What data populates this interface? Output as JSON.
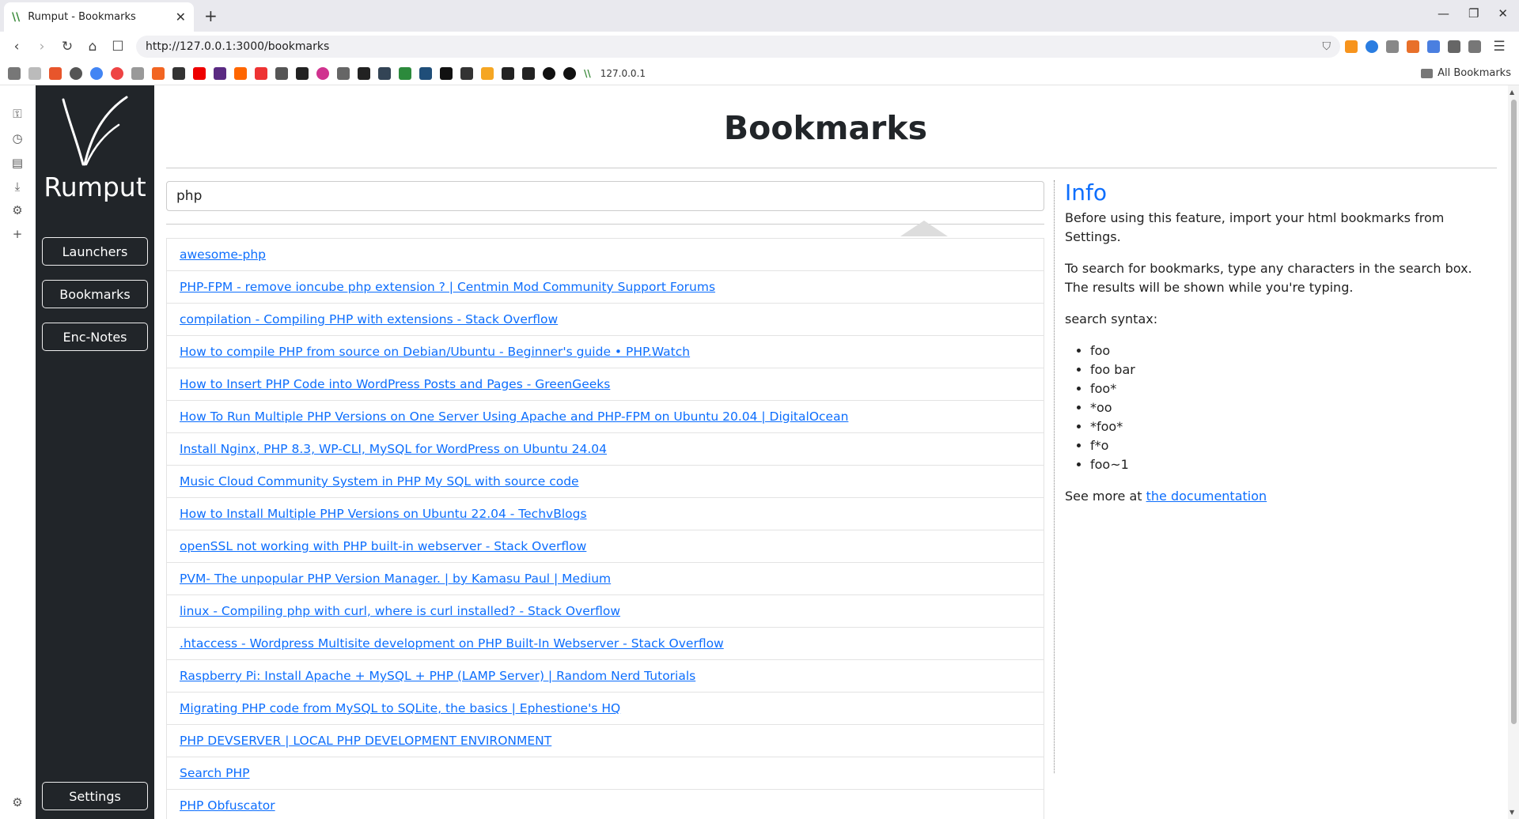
{
  "browser": {
    "tab_title": "Rumput - Bookmarks",
    "url": "http://127.0.0.1:3000/bookmarks",
    "bookmarks_host": "127.0.0.1",
    "all_bookmarks": "All Bookmarks"
  },
  "sidebar": {
    "brand": "Rumput",
    "nav": [
      "Launchers",
      "Bookmarks",
      "Enc-Notes"
    ],
    "settings": "Settings"
  },
  "page": {
    "title": "Bookmarks",
    "search_value": "php"
  },
  "results": [
    "awesome-php",
    "PHP-FPM - remove ioncube php extension ? | Centmin Mod Community Support Forums",
    "compilation - Compiling PHP with extensions - Stack Overflow",
    "How to compile PHP from source on Debian/Ubuntu - Beginner's guide • PHP.Watch",
    "How to Insert PHP Code into WordPress Posts and Pages - GreenGeeks",
    "How To Run Multiple PHP Versions on One Server Using Apache and PHP-FPM on Ubuntu 20.04 | DigitalOcean",
    "Install Nginx, PHP 8.3, WP-CLI, MySQL for WordPress on Ubuntu 24.04",
    "Music Cloud Community System in PHP My SQL with source code",
    "How to Install Multiple PHP Versions on Ubuntu 22.04 - TechvBlogs",
    "openSSL not working with PHP built-in webserver - Stack Overflow",
    "PVM- The unpopular PHP Version Manager. | by Kamasu Paul | Medium",
    "linux - Compiling php with curl, where is curl installed? - Stack Overflow",
    ".htaccess - Wordpress Multisite development on PHP Built-In Webserver - Stack Overflow",
    "Raspberry Pi: Install Apache + MySQL + PHP (LAMP Server) | Random Nerd Tutorials",
    "Migrating PHP code from MySQL to SQLite, the basics | Ephestione's HQ",
    "PHP DEVSERVER | LOCAL PHP DEVELOPMENT ENVIRONMENT",
    "Search PHP",
    "PHP Obfuscator"
  ],
  "info": {
    "heading": "Info",
    "p1": "Before using this feature, import your html bookmarks from Settings.",
    "p2": "To search for bookmarks, type any characters in the search box. The results will be shown while you're typing.",
    "p3": "search syntax:",
    "syntax": [
      "foo",
      "foo bar",
      "foo*",
      "*oo",
      "*foo*",
      "f*o",
      "foo~1"
    ],
    "more_prefix": "See more at ",
    "more_link": "the documentation"
  },
  "colors": {
    "sidebar_bg": "#212529",
    "link": "#0d6efd"
  }
}
